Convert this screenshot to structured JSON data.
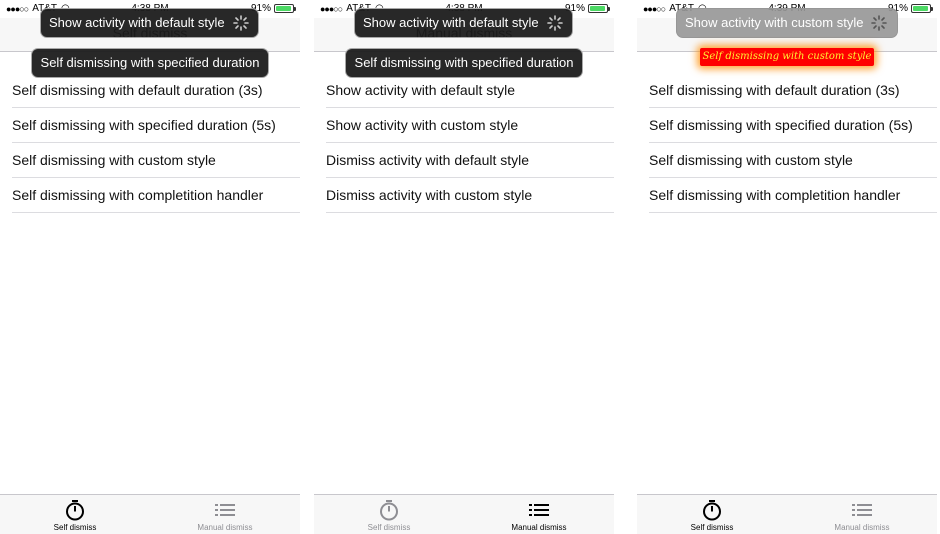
{
  "status": {
    "carrier": "AT&T",
    "battery": "91%"
  },
  "screens": [
    {
      "time": "4:38 PM",
      "nav_title": "Self dismiss",
      "toasts": [
        "Show activity with default style",
        "Self dismissing with specified duration"
      ],
      "rows": [
        "Self dismissing with default duration (3s)",
        "Self dismissing with specified duration (5s)",
        "Self dismissing with custom style",
        "Self dismissing with completition handler"
      ]
    },
    {
      "time": "4:38 PM",
      "nav_title": "Manual dismiss",
      "toasts": [
        "Show activity with default style",
        "Self dismissing with specified duration"
      ],
      "rows": [
        "Show activity with default style",
        "Show activity with custom style",
        "Dismiss activity with default style",
        "Dismiss activity with custom style"
      ]
    },
    {
      "time": "4:39 PM",
      "nav_title": "",
      "toasts": [
        "Show activity with custom style",
        "Self dismissing with custom style"
      ],
      "rows": [
        "Self dismissing with default duration (3s)",
        "Self dismissing with specified duration (5s)",
        "Self dismissing with custom style",
        "Self dismissing with completition handler"
      ]
    }
  ],
  "tabs": [
    {
      "label": "Self dismiss",
      "icon": "stopwatch-icon"
    },
    {
      "label": "Manual dismiss",
      "icon": "list-icon"
    }
  ],
  "colors": {
    "battery": "#4cd964",
    "custom_toast_bg": "#ff0000",
    "custom_toast_text": "#ffee33"
  }
}
